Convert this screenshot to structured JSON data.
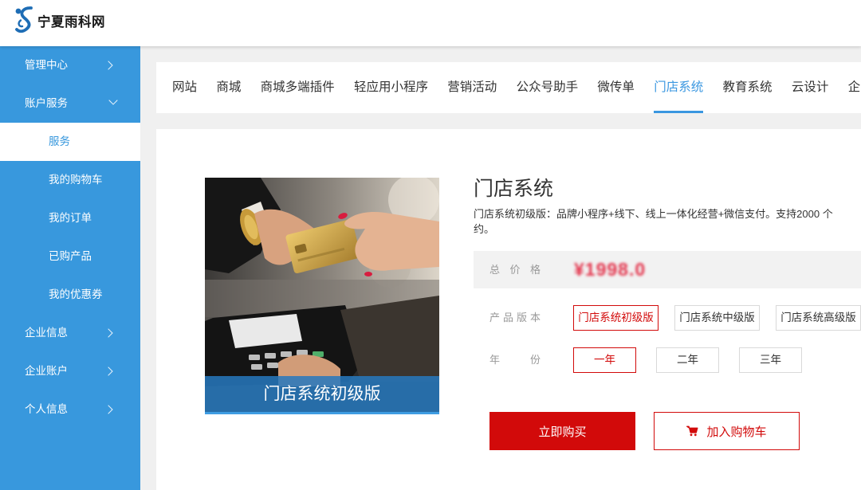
{
  "header": {
    "logo_text": "宁夏雨科网",
    "logo_icon": "swirl-logo-icon"
  },
  "sidebar": {
    "items": [
      {
        "label": "管理中心",
        "kind": "section",
        "icon": "chevron-right-icon"
      },
      {
        "label": "账户服务",
        "kind": "section",
        "icon": "chevron-down-icon",
        "expanded": true
      },
      {
        "label": "服务",
        "kind": "sub",
        "active": true
      },
      {
        "label": "我的购物车",
        "kind": "sub"
      },
      {
        "label": "我的订单",
        "kind": "sub"
      },
      {
        "label": "已购产品",
        "kind": "sub"
      },
      {
        "label": "我的优惠券",
        "kind": "sub"
      },
      {
        "label": "企业信息",
        "kind": "section",
        "icon": "chevron-right-icon"
      },
      {
        "label": "企业账户",
        "kind": "section",
        "icon": "chevron-right-icon"
      },
      {
        "label": "个人信息",
        "kind": "section",
        "icon": "chevron-right-icon"
      }
    ]
  },
  "tabs": {
    "items": [
      "网站",
      "商城",
      "商城多端插件",
      "轻应用小程序",
      "营销活动",
      "公众号助手",
      "微传单",
      "门店系统",
      "教育系统",
      "云设计",
      "企"
    ],
    "active": "门店系统"
  },
  "product": {
    "image_caption": "门店系统初级版",
    "title": "门店系统",
    "description_lines": [
      "门店系统初级版：品牌小程序+线下、线上一体化经营+微信支付。支持2000 个",
      "约。"
    ],
    "price": {
      "label": "总 价 格",
      "value": "¥1998.0"
    },
    "version": {
      "label": "产品版本",
      "options": [
        "门店系统初级版",
        "门店系统中级版",
        "门店系统高级版"
      ],
      "selected": "门店系统初级版"
    },
    "year": {
      "label": "年 份",
      "options": [
        "一年",
        "二年",
        "三年"
      ],
      "selected": "一年"
    },
    "buy_button": "立即购买",
    "cart_button": "加入购物车",
    "cart_icon": "shopping-cart-icon"
  },
  "colors": {
    "sidebar_bg": "#3898dd",
    "accent_blue": "#3a97e0",
    "accent_red": "#d20a0a",
    "price_red": "#e3354d",
    "page_bg": "#f0f0f0"
  }
}
